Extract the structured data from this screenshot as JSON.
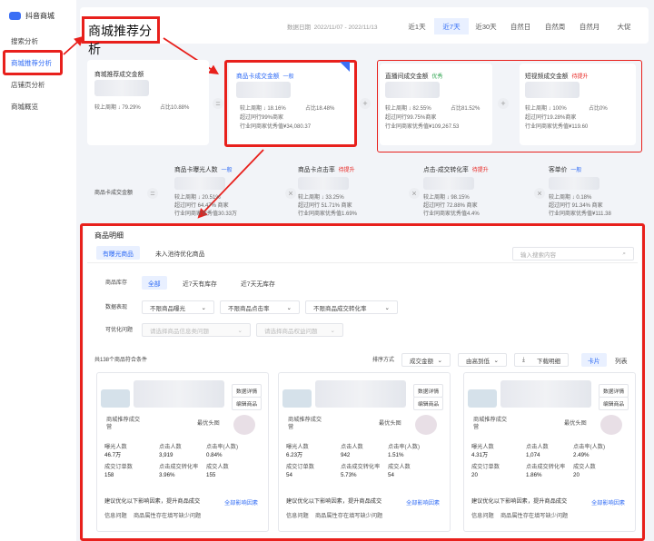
{
  "app": {
    "name": "抖音商城"
  },
  "sidebar": {
    "items": [
      {
        "label": "搜索分析"
      },
      {
        "label": "商城推荐分析"
      },
      {
        "label": "店铺页分析"
      },
      {
        "label": "商城概览"
      }
    ]
  },
  "header": {
    "title": "商城推荐分析",
    "date_label": "数据日期",
    "date_range": "2022/11/07 - 2022/11/13",
    "tabs": [
      "近1天",
      "近7天",
      "近30天",
      "自然日",
      "自然周",
      "自然月",
      "大促"
    ],
    "active_tab": "近7天"
  },
  "funnel": {
    "total": {
      "label": "商城推荐成交金额",
      "wow": "较上周期 ↓ 79.29%",
      "share": "占比10.88%"
    },
    "card": {
      "label": "商品卡成交金额",
      "tag": "一般",
      "wow": "较上周期 ↓ 18.16%",
      "share": "占比18.48%",
      "peer": "超过同行99%商家",
      "excellent": "行业同商家优秀值¥34,080.37"
    },
    "live": {
      "label": "直播间成交金额",
      "tag": "优秀",
      "wow": "较上周期 ↓ 82.55%",
      "share": "占比81.52%",
      "peer": "超过同行99.75%商家",
      "excellent": "行业同商家优秀值¥109,267.53"
    },
    "video": {
      "label": "短视频成交金额",
      "tag": "待提升",
      "wow": "较上周期 ↓ 100%",
      "share": "占比0%",
      "peer": "超过同行19.28%商家",
      "excellent": "行业同商家优秀值¥119.60"
    }
  },
  "formula": {
    "left_label": "商品卡成交金额",
    "items": [
      {
        "label": "商品卡曝光人数",
        "tag": "一般",
        "tag_type": "b",
        "wow": "较上周期 ↓ 20.51%",
        "peer": "超过同行 64.47% 商家",
        "excellent": "行业同商家优秀值30.33万"
      },
      {
        "label": "商品卡点击率",
        "tag": "待提升",
        "tag_type": "r",
        "wow": "较上周期 ↓ 33.25%",
        "peer": "超过同行 51.71% 商家",
        "excellent": "行业同商家优秀值1.69%"
      },
      {
        "label": "点击-成交转化率",
        "tag": "待提升",
        "tag_type": "r",
        "wow": "较上周期 ↓ 98.15%",
        "peer": "超过同行 72.88% 商家",
        "excellent": "行业同商家优秀值4.4%"
      },
      {
        "label": "客单价",
        "tag": "一般",
        "tag_type": "b",
        "wow": "较上周期 ↓ 0.18%",
        "peer": "超过同行 91.34% 商家",
        "excellent": "行业同商家优秀值¥111.38"
      }
    ]
  },
  "detail": {
    "title": "商品明细",
    "tabs": [
      "有曝光商品",
      "未入池待优化商品"
    ],
    "search_placeholder": "输入搜索内容",
    "stock_label": "商品库存",
    "stock_opts": [
      "全部",
      "近7天有库存",
      "近7天无库存"
    ],
    "perf_label": "数据表现",
    "perf_opts": [
      "不限商品曝光",
      "不限商品点击率",
      "不限商品成交转化率"
    ],
    "issue_label": "可优化问题",
    "issue_opts": [
      "请选择商品信息类问题",
      "请选择商品权益问题"
    ],
    "count": "共138个商品符合条件",
    "sort_label": "排序方式",
    "sort_value": "成交金额",
    "order_value": "由高到低",
    "download": "下载明细",
    "view_card": "卡片",
    "view_list": "列表",
    "products": [
      {
        "btn1": "数据详情",
        "btn2": "编辑商品",
        "src_label": "商城推荐成交",
        "src_sub": "营",
        "best_label": "最优头图",
        "metrics": [
          [
            "曝光人数",
            "46.7万"
          ],
          [
            "点击人数",
            "3,919"
          ],
          [
            "点击率(人数)",
            "0.84%"
          ],
          [
            "成交订单数",
            "158"
          ],
          [
            "点击成交转化率",
            "3.96%"
          ],
          [
            "成交人数",
            "155"
          ]
        ],
        "advice": "建议优化以下影响因素，提升商品成交",
        "advice_link": "全部影响因素",
        "issues": [
          "信息问题",
          "商品属性存在填写缺少问题"
        ]
      },
      {
        "btn1": "数据详情",
        "btn2": "编辑商品",
        "src_label": "商城推荐成交",
        "src_sub": "营",
        "best_label": "最优头图",
        "metrics": [
          [
            "曝光人数",
            "6.23万"
          ],
          [
            "点击人数",
            "942"
          ],
          [
            "点击率(人数)",
            "1.51%"
          ],
          [
            "成交订单数",
            "54"
          ],
          [
            "点击成交转化率",
            "5.73%"
          ],
          [
            "成交人数",
            "54"
          ]
        ],
        "advice": "建议优化以下影响因素，提升商品成交",
        "advice_link": "全部影响因素",
        "issues": [
          "信息问题",
          "商品属性存在填写缺少问题"
        ]
      },
      {
        "btn1": "数据详情",
        "btn2": "编辑商品",
        "src_label": "商城推荐成交",
        "src_sub": "营",
        "best_label": "最优头图",
        "metrics": [
          [
            "曝光人数",
            "4.31万"
          ],
          [
            "点击人数",
            "1,074"
          ],
          [
            "点击率(人数)",
            "2.49%"
          ],
          [
            "成交订单数",
            "20"
          ],
          [
            "点击成交转化率",
            "1.86%"
          ],
          [
            "成交人数",
            "20"
          ]
        ],
        "advice": "建议优化以下影响因素，提升商品成交",
        "advice_link": "全部影响因素",
        "issues": [
          "信息问题",
          "商品属性存在填写缺少问题"
        ]
      }
    ]
  }
}
